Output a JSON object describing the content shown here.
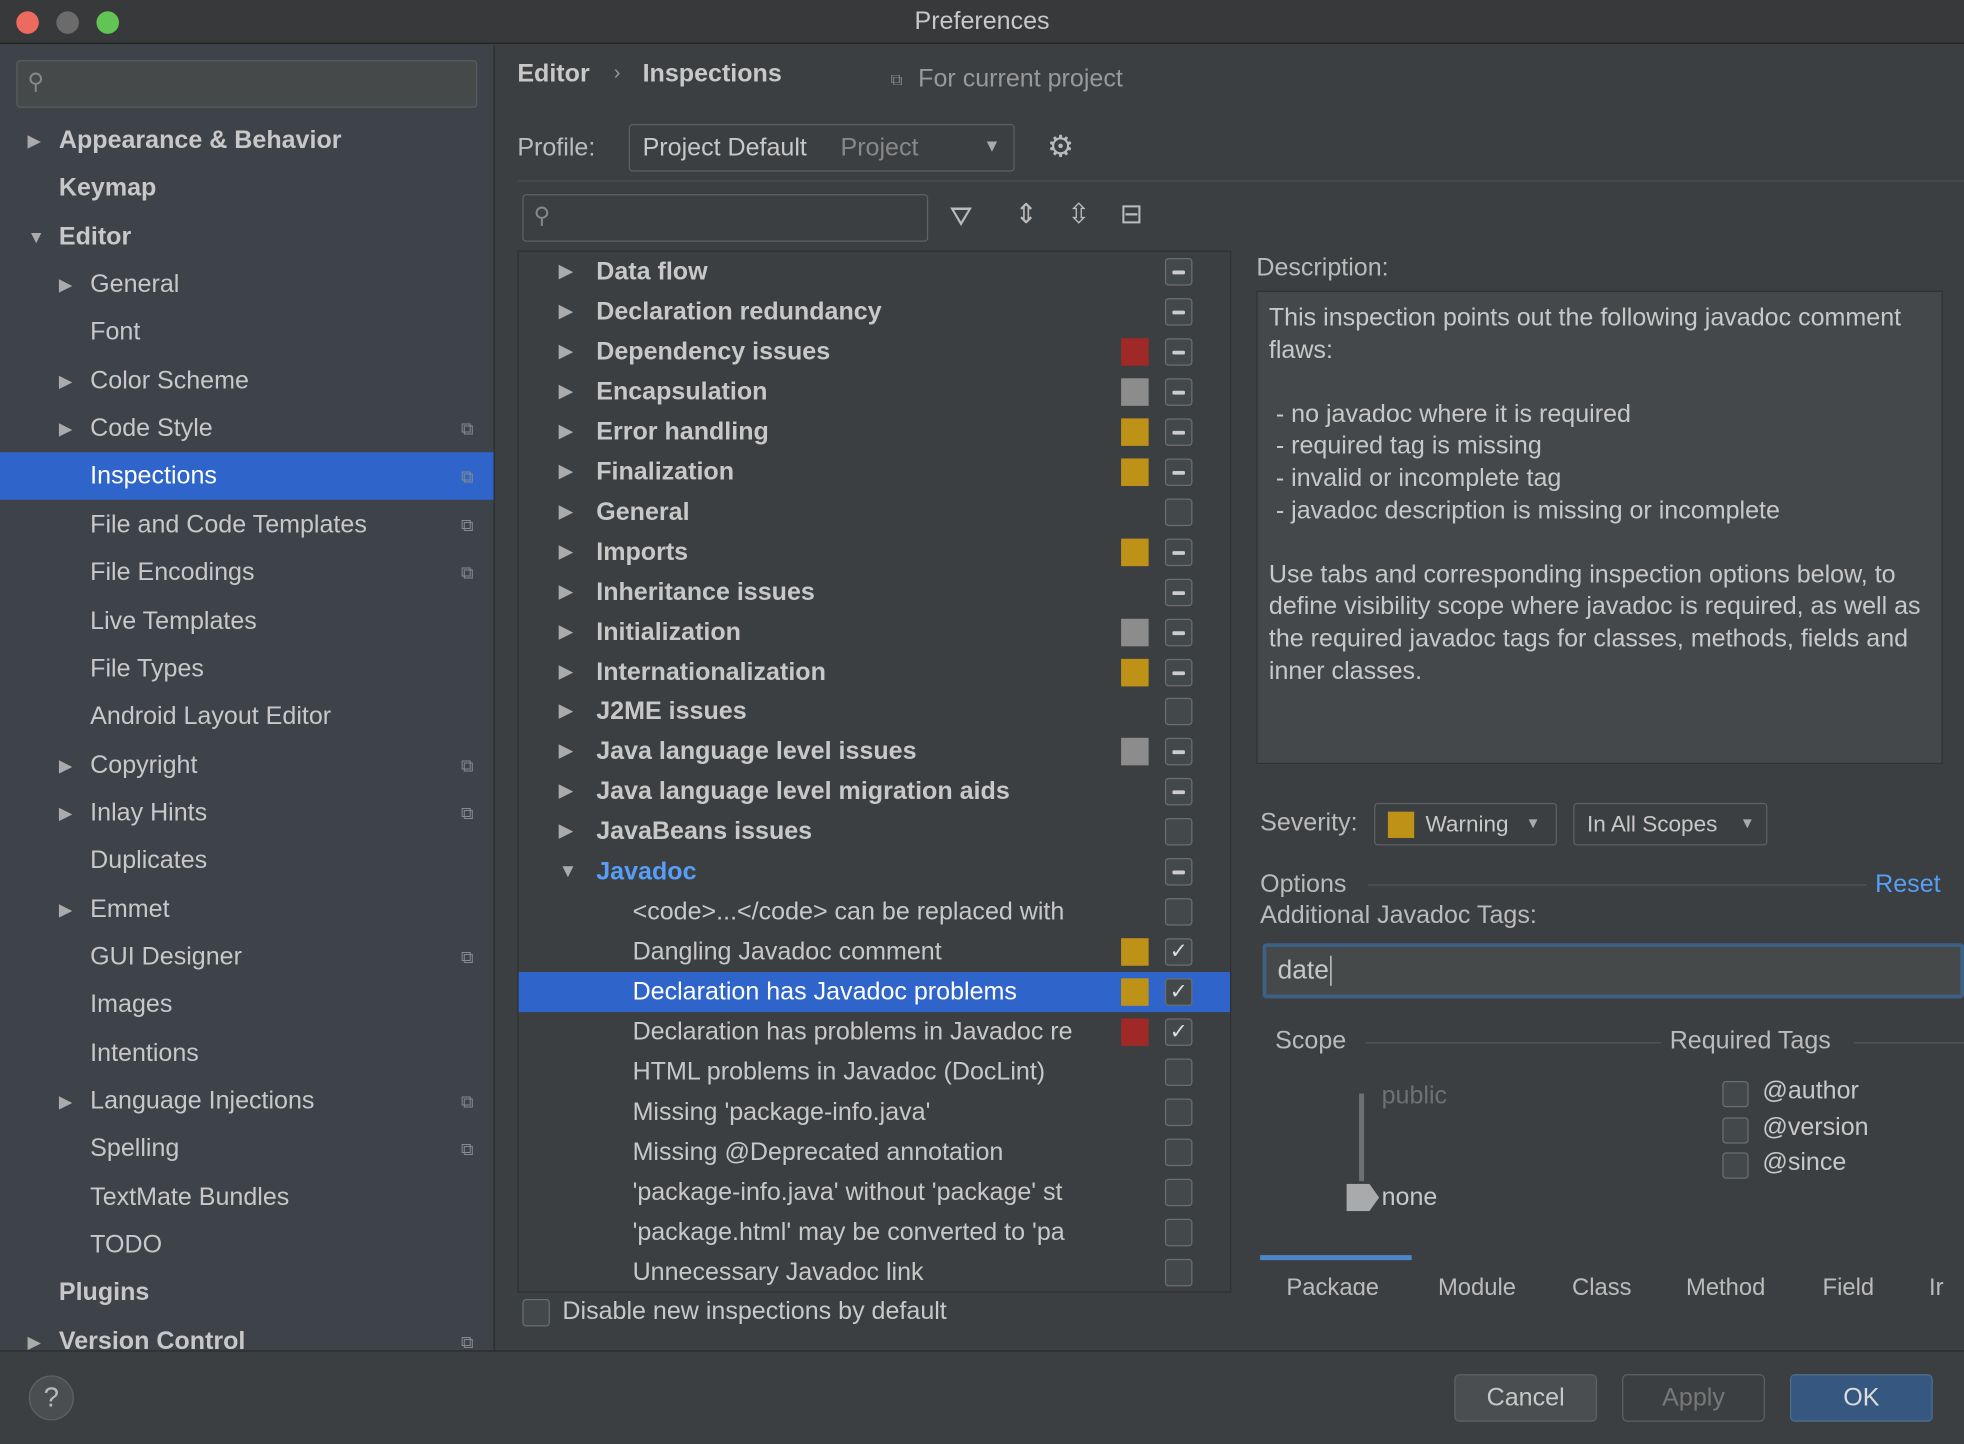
{
  "window": {
    "title": "Preferences"
  },
  "sidebar": {
    "search_placeholder": "",
    "items": [
      {
        "label": "Appearance & Behavior",
        "level": 0,
        "arrow": "right",
        "bold": true
      },
      {
        "label": "Keymap",
        "level": 0,
        "bold": true
      },
      {
        "label": "Editor",
        "level": 0,
        "arrow": "down",
        "bold": true
      },
      {
        "label": "General",
        "level": 1,
        "arrow": "right"
      },
      {
        "label": "Font",
        "level": 1
      },
      {
        "label": "Color Scheme",
        "level": 1,
        "arrow": "right"
      },
      {
        "label": "Code Style",
        "level": 1,
        "arrow": "right",
        "project": true
      },
      {
        "label": "Inspections",
        "level": 1,
        "project": true,
        "selected": true
      },
      {
        "label": "File and Code Templates",
        "level": 1,
        "project": true
      },
      {
        "label": "File Encodings",
        "level": 1,
        "project": true
      },
      {
        "label": "Live Templates",
        "level": 1
      },
      {
        "label": "File Types",
        "level": 1
      },
      {
        "label": "Android Layout Editor",
        "level": 1
      },
      {
        "label": "Copyright",
        "level": 1,
        "arrow": "right",
        "project": true
      },
      {
        "label": "Inlay Hints",
        "level": 1,
        "arrow": "right",
        "project": true
      },
      {
        "label": "Duplicates",
        "level": 1
      },
      {
        "label": "Emmet",
        "level": 1,
        "arrow": "right"
      },
      {
        "label": "GUI Designer",
        "level": 1,
        "project": true
      },
      {
        "label": "Images",
        "level": 1
      },
      {
        "label": "Intentions",
        "level": 1
      },
      {
        "label": "Language Injections",
        "level": 1,
        "arrow": "right",
        "project": true
      },
      {
        "label": "Spelling",
        "level": 1,
        "project": true
      },
      {
        "label": "TextMate Bundles",
        "level": 1
      },
      {
        "label": "TODO",
        "level": 1
      },
      {
        "label": "Plugins",
        "level": 0,
        "bold": true
      },
      {
        "label": "Version Control",
        "level": 0,
        "arrow": "right",
        "bold": true,
        "project": true
      }
    ]
  },
  "header": {
    "breadcrumb": [
      "Editor",
      "Inspections"
    ],
    "scope_note": "For current project"
  },
  "profile": {
    "label": "Profile:",
    "value": "Project Default",
    "tag": "Project"
  },
  "colors": {
    "error": "#9e2927",
    "warning": "#be9117",
    "weak": "#8c8c8c",
    "accent": "#2f65ca",
    "link": "#589df6"
  },
  "tree": {
    "search_placeholder": "",
    "rows": [
      {
        "label": "Data flow",
        "group": true,
        "sev": null,
        "cb": "mixed"
      },
      {
        "label": "Declaration redundancy",
        "group": true,
        "sev": null,
        "cb": "mixed"
      },
      {
        "label": "Dependency issues",
        "group": true,
        "sev": "error",
        "cb": "mixed"
      },
      {
        "label": "Encapsulation",
        "group": true,
        "sev": "weak",
        "cb": "mixed"
      },
      {
        "label": "Error handling",
        "group": true,
        "sev": "warning",
        "cb": "mixed"
      },
      {
        "label": "Finalization",
        "group": true,
        "sev": "warning",
        "cb": "mixed"
      },
      {
        "label": "General",
        "group": true,
        "sev": null,
        "cb": "off"
      },
      {
        "label": "Imports",
        "group": true,
        "sev": "warning",
        "cb": "mixed"
      },
      {
        "label": "Inheritance issues",
        "group": true,
        "sev": null,
        "cb": "mixed"
      },
      {
        "label": "Initialization",
        "group": true,
        "sev": "weak",
        "cb": "mixed"
      },
      {
        "label": "Internationalization",
        "group": true,
        "sev": "warning",
        "cb": "mixed"
      },
      {
        "label": "J2ME issues",
        "group": true,
        "sev": null,
        "cb": "off"
      },
      {
        "label": "Java language level issues",
        "group": true,
        "sev": "weak",
        "cb": "mixed"
      },
      {
        "label": "Java language level migration aids",
        "group": true,
        "sev": null,
        "cb": "mixed"
      },
      {
        "label": "JavaBeans issues",
        "group": true,
        "sev": null,
        "cb": "off"
      },
      {
        "label": "Javadoc",
        "group": true,
        "expanded": true,
        "sev": null,
        "cb": "mixed"
      },
      {
        "label": "<code>...</code> can be replaced with",
        "sev": null,
        "cb": "off"
      },
      {
        "label": "Dangling Javadoc comment",
        "sev": "warning",
        "cb": "on"
      },
      {
        "label": "Declaration has Javadoc problems",
        "sev": "warning",
        "cb": "on",
        "selected": true
      },
      {
        "label": "Declaration has problems in Javadoc re",
        "sev": "error",
        "cb": "on"
      },
      {
        "label": "HTML problems in Javadoc (DocLint)",
        "sev": null,
        "cb": "off"
      },
      {
        "label": "Missing 'package-info.java'",
        "sev": null,
        "cb": "off"
      },
      {
        "label": "Missing @Deprecated annotation",
        "sev": null,
        "cb": "off"
      },
      {
        "label": "'package-info.java' without 'package' st",
        "sev": null,
        "cb": "off"
      },
      {
        "label": "'package.html' may be converted to 'pa",
        "sev": null,
        "cb": "off"
      },
      {
        "label": "Unnecessary Javadoc link",
        "sev": null,
        "cb": "off"
      }
    ]
  },
  "disable_new": {
    "label": "Disable new inspections by default",
    "checked": false
  },
  "description": {
    "label": "Description:",
    "text": "This inspection points out the following javadoc comment flaws:\n\n - no javadoc where it is required\n - required tag is missing\n - invalid or incomplete tag\n - javadoc description is missing or incomplete\n\nUse tabs and corresponding inspection options below, to define visibility scope where javadoc is required, as well as the required javadoc tags for classes, methods, fields and inner classes."
  },
  "severity": {
    "label": "Severity:",
    "value": "Warning",
    "scope": "In All Scopes"
  },
  "options": {
    "label": "Options",
    "reset": "Reset",
    "tags_label": "Additional Javadoc Tags:",
    "tags_value": "date",
    "scope_label": "Scope",
    "required_label": "Required Tags",
    "slider_top": "public",
    "slider_value": "none",
    "required_tags": [
      {
        "label": "@author",
        "checked": false
      },
      {
        "label": "@version",
        "checked": false
      },
      {
        "label": "@since",
        "checked": false
      }
    ],
    "tabs": [
      "Package",
      "Module",
      "Class",
      "Method",
      "Field",
      "Ir"
    ],
    "active_tab": "Package"
  },
  "buttons": {
    "help": "?",
    "cancel": "Cancel",
    "apply": "Apply",
    "ok": "OK"
  }
}
